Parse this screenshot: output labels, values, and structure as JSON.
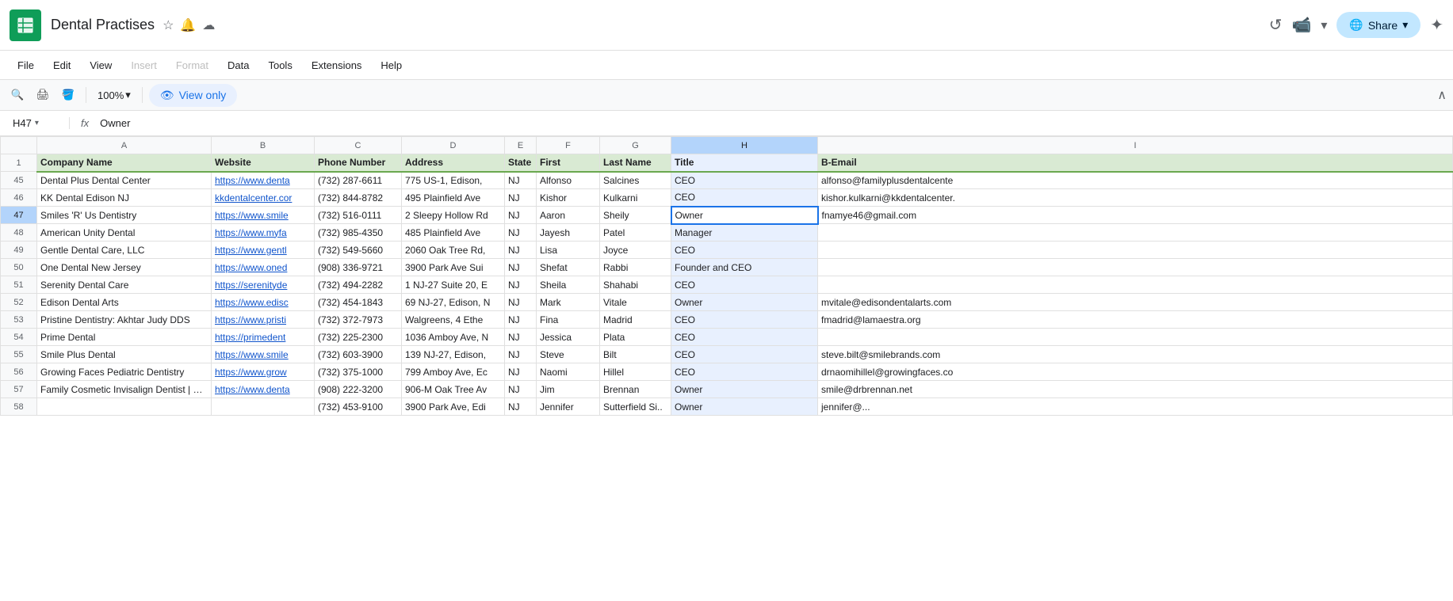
{
  "app": {
    "icon_color": "#0f9d58",
    "title": "Dental Practises",
    "share_label": "Share"
  },
  "menu": {
    "items": [
      "File",
      "Edit",
      "View",
      "Insert",
      "Format",
      "Data",
      "Tools",
      "Extensions",
      "Help"
    ],
    "dimmed": [
      "Insert",
      "Format"
    ]
  },
  "toolbar": {
    "zoom": "100%",
    "view_only_label": "View only"
  },
  "formula_bar": {
    "cell_ref": "H47",
    "formula": "Owner"
  },
  "columns": {
    "row_header": "",
    "headers": [
      "A",
      "B",
      "C",
      "D",
      "E",
      "F",
      "G",
      "H",
      "I"
    ]
  },
  "header_row": {
    "row_num": "1",
    "cols": [
      "Company Name",
      "Website",
      "Phone Number",
      "Address",
      "State",
      "First",
      "Last Name",
      "Title",
      "B-Email"
    ]
  },
  "rows": [
    {
      "row_num": "45",
      "cols": [
        "Dental Plus Dental Center",
        "https://www.denta",
        "(732) 287-6611",
        "775 US-1, Edison,",
        "NJ",
        "Alfonso",
        "Salcines",
        "CEO",
        "alfonso@familyplusdentalcente"
      ]
    },
    {
      "row_num": "46",
      "cols": [
        "KK Dental Edison NJ",
        "kkdentalcenter.cor",
        "(732) 844-8782",
        "495 Plainfield Ave",
        "NJ",
        "Kishor",
        "Kulkarni",
        "CEO",
        "kishor.kulkarni@kkdentalcenter."
      ]
    },
    {
      "row_num": "47",
      "cols": [
        "Smiles 'R' Us Dentistry",
        "https://www.smile",
        "(732) 516-0111",
        "2 Sleepy Hollow Rd",
        "NJ",
        "Aaron",
        "Sheily",
        "Owner",
        "fnamye46@gmail.com"
      ],
      "active_col": 7
    },
    {
      "row_num": "48",
      "cols": [
        "American Unity Dental",
        "https://www.myfa",
        "(732) 985-4350",
        "485 Plainfield Ave",
        "NJ",
        "Jayesh",
        "Patel",
        "Manager",
        ""
      ]
    },
    {
      "row_num": "49",
      "cols": [
        "Gentle Dental Care, LLC",
        "https://www.gentl",
        "(732) 549-5660",
        "2060 Oak Tree Rd,",
        "NJ",
        "Lisa",
        "Joyce",
        "CEO",
        ""
      ]
    },
    {
      "row_num": "50",
      "cols": [
        "One Dental New Jersey",
        "https://www.oned",
        "(908) 336-9721",
        "3900 Park Ave Sui",
        "NJ",
        "Shefat",
        "Rabbi",
        "Founder and CEO",
        ""
      ]
    },
    {
      "row_num": "51",
      "cols": [
        "Serenity Dental Care",
        "https://serenityde",
        "(732) 494-2282",
        "1 NJ-27 Suite 20, E",
        "NJ",
        "Sheila",
        "Shahabi",
        "CEO",
        ""
      ]
    },
    {
      "row_num": "52",
      "cols": [
        "Edison Dental Arts",
        "https://www.edisc",
        "(732) 454-1843",
        "69 NJ-27, Edison, N",
        "NJ",
        "Mark",
        "Vitale",
        "Owner",
        "mvitale@edisondentalarts.com"
      ]
    },
    {
      "row_num": "53",
      "cols": [
        "Pristine Dentistry: Akhtar Judy DDS",
        "https://www.pristi",
        "(732) 372-7973",
        "Walgreens, 4 Ethe",
        "NJ",
        "Fina",
        "Madrid",
        "CEO",
        "fmadrid@lamaestra.org"
      ]
    },
    {
      "row_num": "54",
      "cols": [
        "Prime Dental",
        "https://primedent",
        "(732) 225-2300",
        "1036 Amboy Ave, N",
        "NJ",
        "Jessica",
        "Plata",
        "CEO",
        ""
      ]
    },
    {
      "row_num": "55",
      "cols": [
        "Smile Plus Dental",
        "https://www.smile",
        "(732) 603-3900",
        "139 NJ-27, Edison,",
        "NJ",
        "Steve",
        "Bilt",
        "CEO",
        "steve.bilt@smilebrands.com"
      ]
    },
    {
      "row_num": "56",
      "cols": [
        "Growing Faces Pediatric Dentistry",
        "https://www.grow",
        "(732) 375-1000",
        "799 Amboy Ave, Ec",
        "NJ",
        "Naomi",
        "Hillel",
        "CEO",
        "drnaomihillel@growingfaces.co"
      ]
    },
    {
      "row_num": "57",
      "cols": [
        "Family Cosmetic Invisalign Dentist | Den",
        "https://www.denta",
        "(908) 222-3200",
        "906-M Oak Tree Av",
        "NJ",
        "Jim",
        "Brennan",
        "Owner",
        "smile@drbrennan.net"
      ]
    },
    {
      "row_num": "58",
      "cols": [
        "",
        "",
        "(732) 453-9100",
        "3900 Park Ave, Edi",
        "NJ",
        "Jennifer",
        "Sutterfield Si..",
        "Owner",
        "jennifer@..."
      ]
    }
  ]
}
